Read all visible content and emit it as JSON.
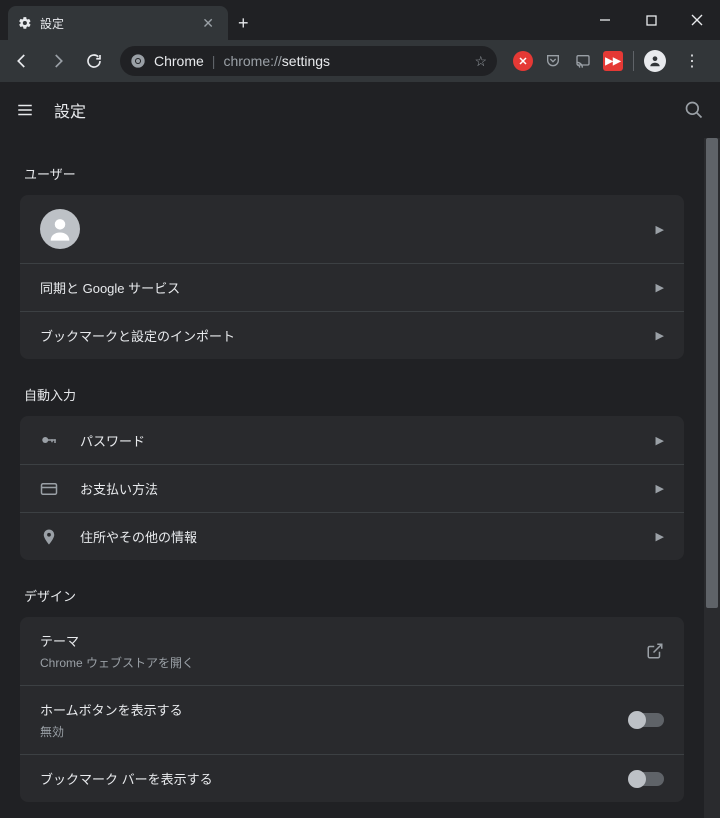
{
  "window": {
    "tab_title": "設定",
    "omnibox": {
      "chrome_label": "Chrome",
      "url_prefix": "chrome://",
      "url_match": "settings"
    }
  },
  "app": {
    "title": "設定"
  },
  "sections": {
    "user": {
      "title": "ユーザー",
      "rows": {
        "sync": "同期と Google サービス",
        "import": "ブックマークと設定のインポート"
      }
    },
    "autofill": {
      "title": "自動入力",
      "rows": {
        "passwords": "パスワード",
        "payments": "お支払い方法",
        "addresses": "住所やその他の情報"
      }
    },
    "appearance": {
      "title": "デザイン",
      "theme": {
        "label": "テーマ",
        "sublabel": "Chrome ウェブストアを開く"
      },
      "home_button": {
        "label": "ホームボタンを表示する",
        "sublabel": "無効",
        "enabled": false
      },
      "bookmarks_bar": {
        "label": "ブックマーク バーを表示する",
        "enabled": false
      }
    }
  }
}
